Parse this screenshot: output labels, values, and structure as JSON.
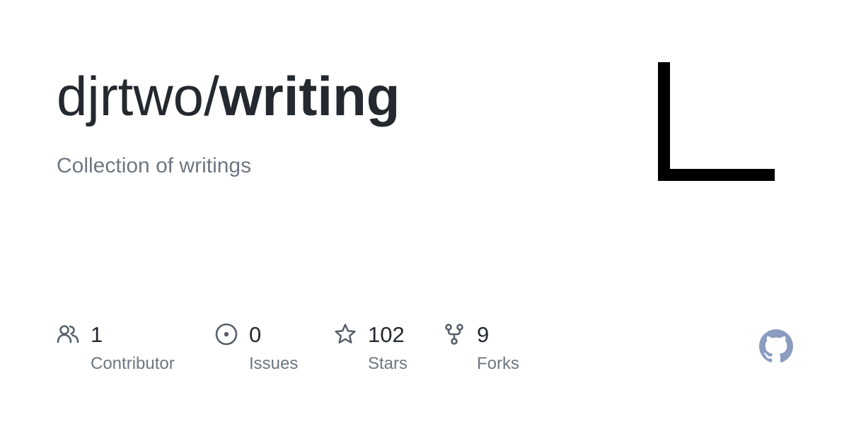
{
  "repo": {
    "owner": "djrtwo/",
    "name": "writing",
    "description": "Collection of writings"
  },
  "stats": [
    {
      "icon": "people-icon",
      "value": "1",
      "label": "Contributor"
    },
    {
      "icon": "issue-circle-icon",
      "value": "0",
      "label": "Issues"
    },
    {
      "icon": "star-icon",
      "value": "102",
      "label": "Stars"
    },
    {
      "icon": "fork-icon",
      "value": "9",
      "label": "Forks"
    }
  ],
  "colors": {
    "title": "#24292f",
    "muted": "#6e7781",
    "icon": "#57606a",
    "logo": "#8b9cc0"
  }
}
